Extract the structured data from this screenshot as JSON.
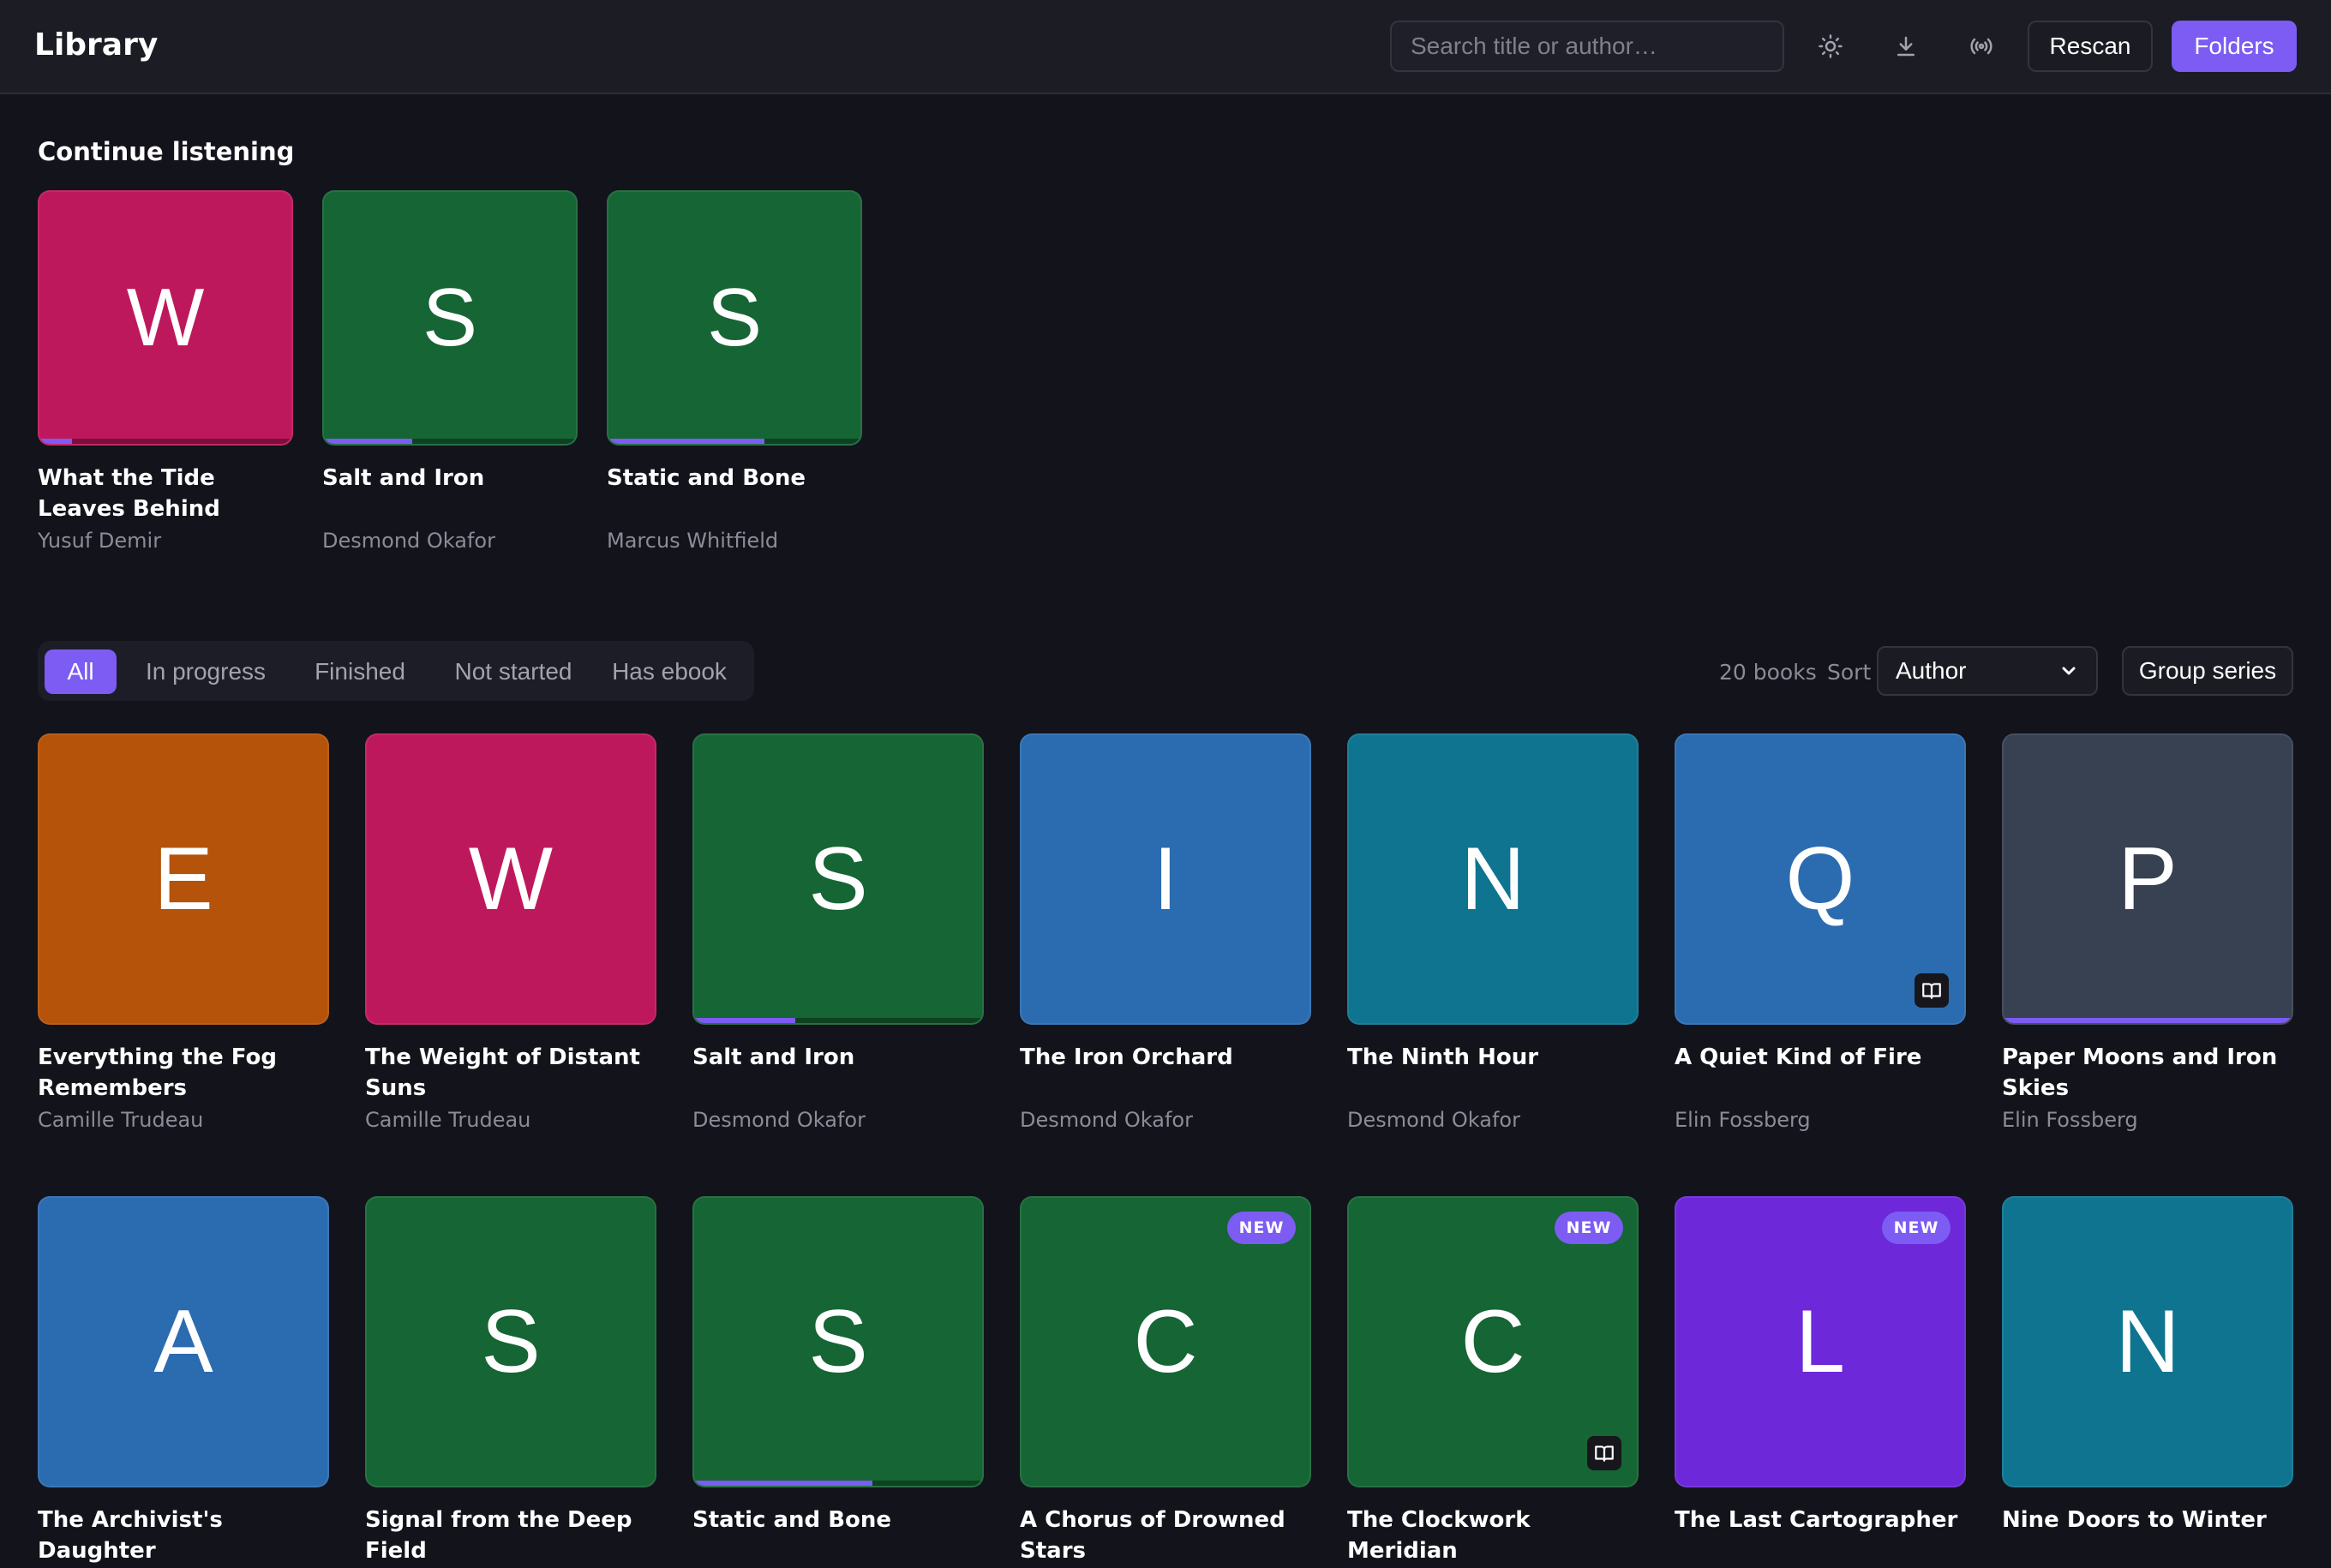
{
  "header": {
    "title": "Library",
    "search_placeholder": "Search title or author…",
    "icons": [
      "sun-icon",
      "download-icon",
      "broadcast-icon"
    ],
    "rescan_label": "Rescan",
    "folders_label": "Folders"
  },
  "continue_listening": {
    "title": "Continue listening",
    "items": [
      {
        "letter": "W",
        "color": "#be185d",
        "title": "What the Tide Leaves Behind",
        "author": "Yusuf Demir",
        "progress": 0.13
      },
      {
        "letter": "S",
        "color": "#166534",
        "title": "Salt and Iron",
        "author": "Desmond Okafor",
        "progress": 0.35
      },
      {
        "letter": "S",
        "color": "#166534",
        "title": "Static and Bone",
        "author": "Marcus Whitfield",
        "progress": 0.62
      }
    ]
  },
  "filters": {
    "tabs": [
      "All",
      "In progress",
      "Finished",
      "Not started",
      "Has ebook"
    ],
    "active": "All"
  },
  "toolbar": {
    "count": "20 books",
    "sort_label": "Sort",
    "sort_value": "Author",
    "group_label": "Group series"
  },
  "accent_color": "#7c5cf2",
  "books": [
    {
      "letter": "E",
      "color": "#b45309",
      "title": "Everything the Fog Remembers",
      "author": "Camille Trudeau"
    },
    {
      "letter": "W",
      "color": "#be185d",
      "title": "The Weight of Distant Suns",
      "author": "Camille Trudeau"
    },
    {
      "letter": "S",
      "color": "#166534",
      "title": "Salt and Iron",
      "author": "Desmond Okafor",
      "progress": 0.35
    },
    {
      "letter": "I",
      "color": "#2b6cb0",
      "title": "The Iron Orchard",
      "author": "Desmond Okafor"
    },
    {
      "letter": "N",
      "color": "#0e7490",
      "title": "The Ninth Hour",
      "author": "Desmond Okafor"
    },
    {
      "letter": "Q",
      "color": "#2b6cb0",
      "title": "A Quiet Kind of Fire",
      "author": "Elin Fossberg",
      "ebook": true
    },
    {
      "letter": "P",
      "color": "#374151",
      "title": "Paper Moons and Iron Skies",
      "author": "Elin Fossberg",
      "progress": 1.0
    },
    {
      "letter": "A",
      "color": "#2b6cb0",
      "title": "The Archivist's Daughter",
      "author": ""
    },
    {
      "letter": "S",
      "color": "#166534",
      "title": "Signal from the Deep Field",
      "author": ""
    },
    {
      "letter": "S",
      "color": "#166534",
      "title": "Static and Bone",
      "author": "",
      "progress": 0.62
    },
    {
      "letter": "C",
      "color": "#166534",
      "title": "A Chorus of Drowned Stars",
      "author": "",
      "new": true
    },
    {
      "letter": "C",
      "color": "#166534",
      "title": "The Clockwork Meridian",
      "author": "",
      "new": true,
      "ebook": true
    },
    {
      "letter": "L",
      "color": "#6d28d9",
      "title": "The Last Cartographer",
      "author": "",
      "new": true
    },
    {
      "letter": "N",
      "color": "#0e7490",
      "title": "Nine Doors to Winter",
      "author": ""
    }
  ],
  "new_badge_label": "NEW"
}
